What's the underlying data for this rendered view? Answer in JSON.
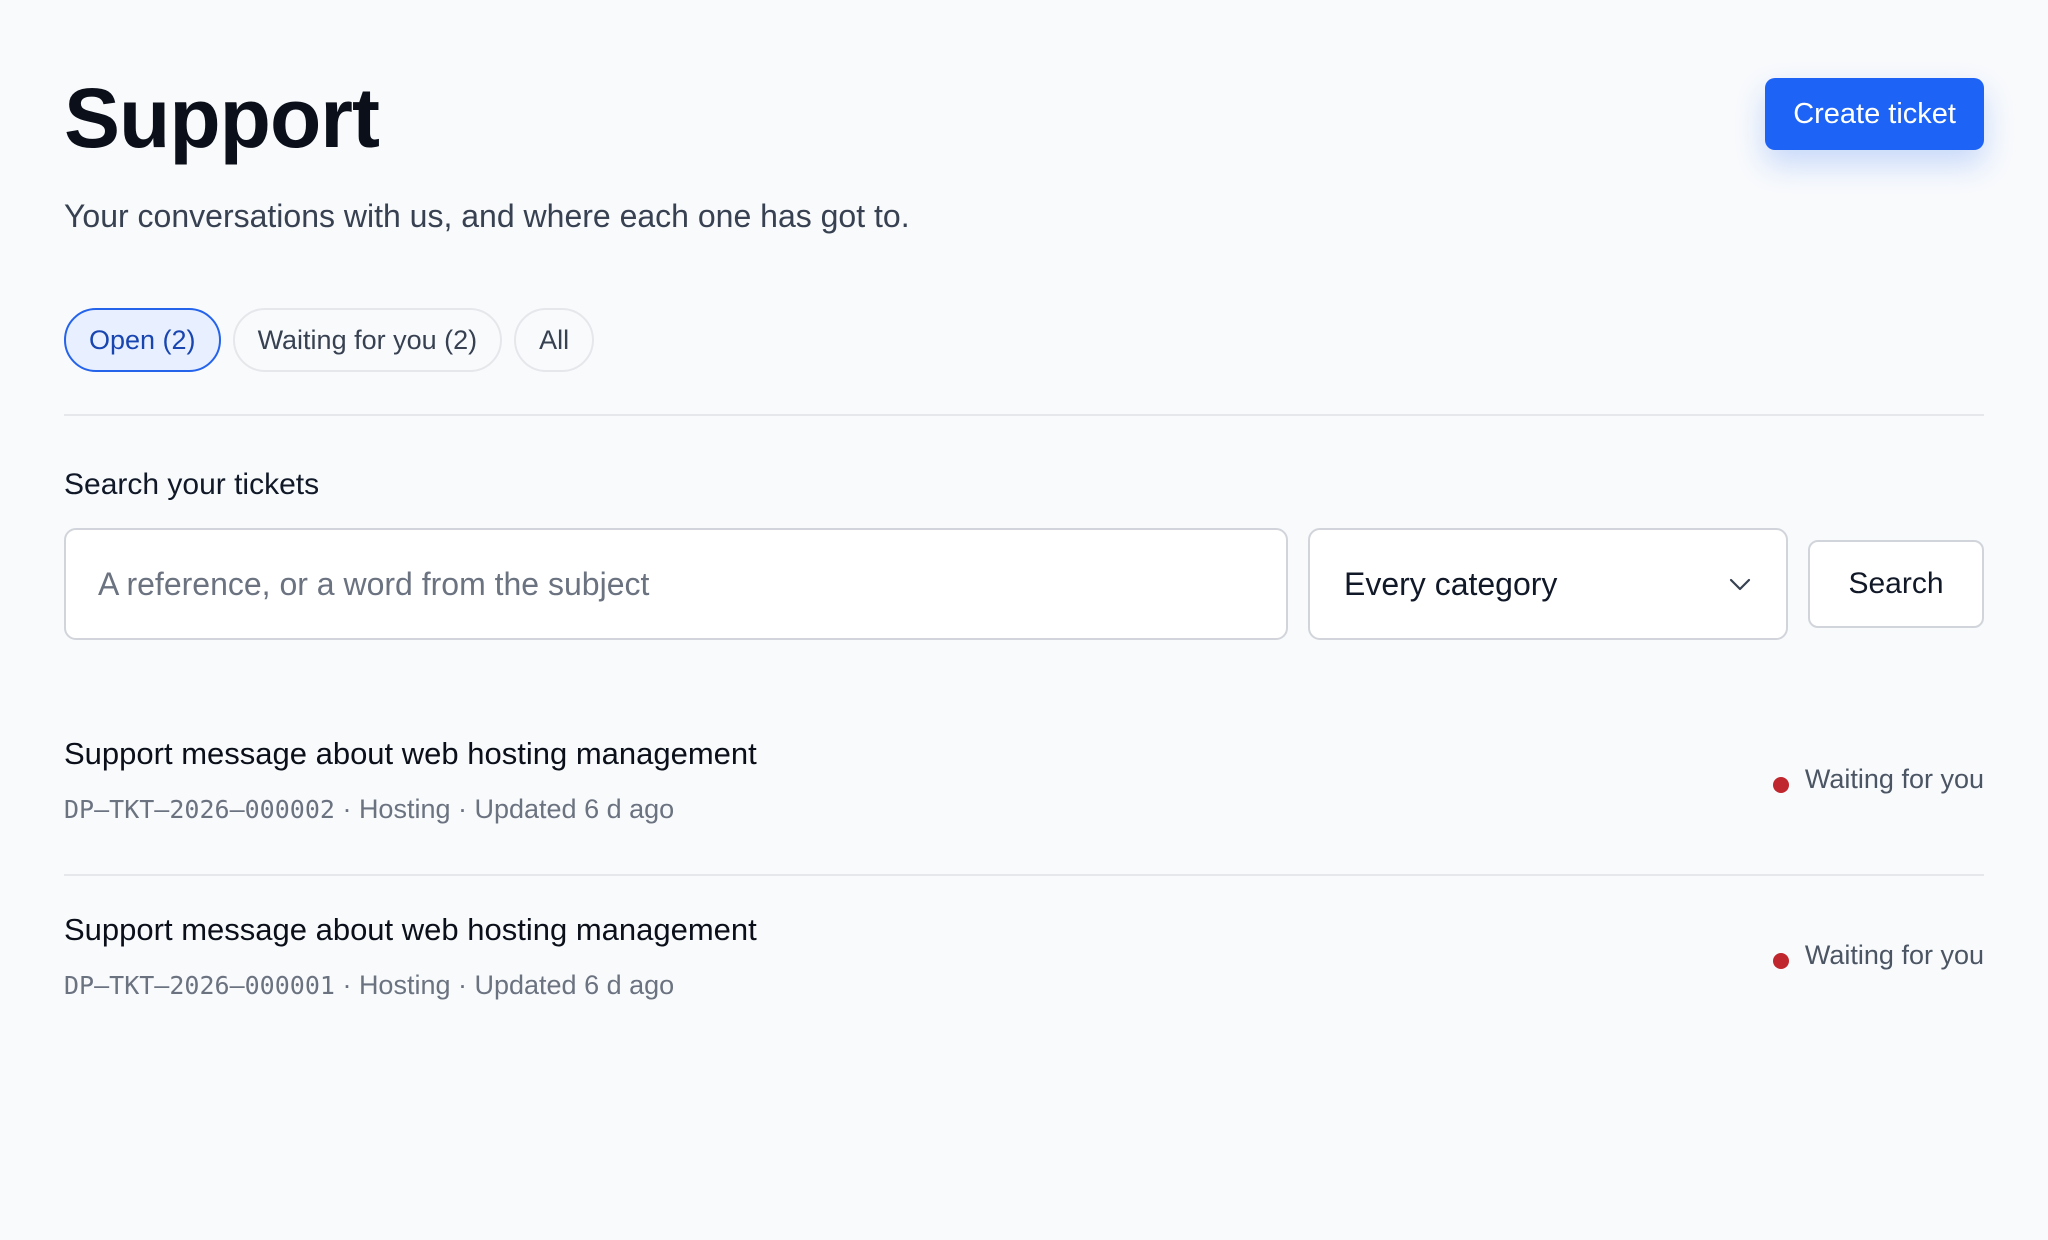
{
  "header": {
    "title": "Support",
    "subtitle": "Your conversations with us, and where each one has got to.",
    "create_button_label": "Create ticket"
  },
  "tabs": [
    {
      "label": "Open (2)",
      "active": true
    },
    {
      "label": "Waiting for you (2)",
      "active": false
    },
    {
      "label": "All",
      "active": false
    }
  ],
  "search": {
    "label": "Search your tickets",
    "placeholder": "A reference, or a word from the subject",
    "value": "",
    "category_selected": "Every category",
    "button_label": "Search"
  },
  "tickets": [
    {
      "subject": "Support message about web hosting management",
      "reference": "DP–TKT–2026–000002",
      "separator": " · ",
      "category": "Hosting",
      "updated": "Updated 6 d ago",
      "status": "Waiting for you"
    },
    {
      "subject": "Support message about web hosting management",
      "reference": "DP–TKT–2026–000001",
      "separator": " · ",
      "category": "Hosting",
      "updated": "Updated 6 d ago",
      "status": "Waiting for you"
    }
  ],
  "colors": {
    "accent": "#1d63f5",
    "status_waiting": "#c0262d",
    "background": "#f8fafc"
  },
  "icons": {
    "category_dropdown": "chevron-down-icon",
    "status_indicator": "status-dot"
  }
}
